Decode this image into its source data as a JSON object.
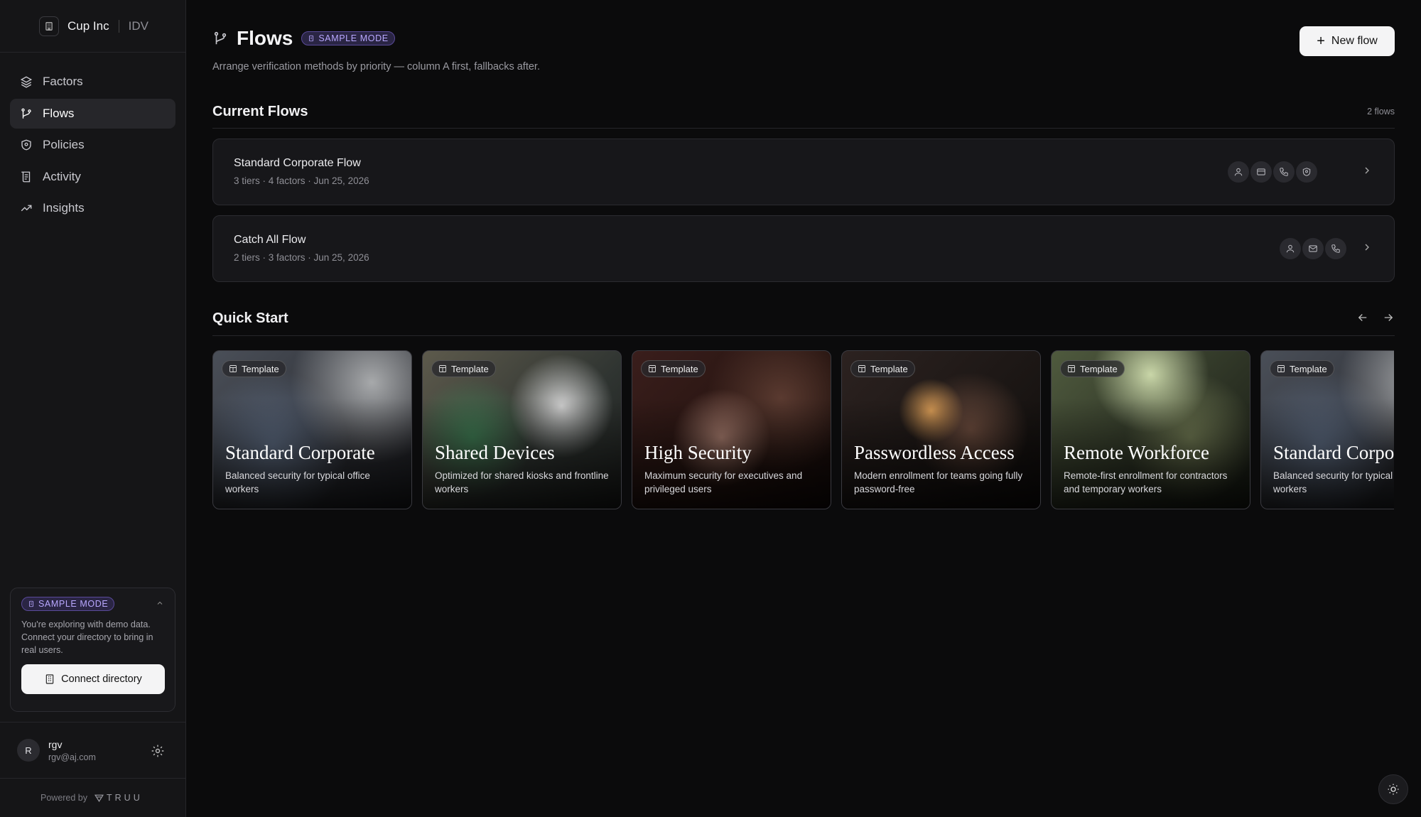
{
  "org": {
    "name": "Cup Inc",
    "product": "IDV"
  },
  "nav": [
    {
      "label": "Factors",
      "icon": "layers-icon"
    },
    {
      "label": "Flows",
      "icon": "flow-icon",
      "active": true
    },
    {
      "label": "Policies",
      "icon": "shield-icon"
    },
    {
      "label": "Activity",
      "icon": "activity-log-icon"
    },
    {
      "label": "Insights",
      "icon": "trend-icon"
    }
  ],
  "sample": {
    "badge": "SAMPLE MODE",
    "text": "You're exploring with demo data. Connect your directory to bring in real users.",
    "button": "Connect directory"
  },
  "user": {
    "initial": "R",
    "name": "rgv",
    "email": "rgv@aj.com"
  },
  "footer": {
    "powered": "Powered by",
    "brand": "TRUU"
  },
  "page": {
    "title": "Flows",
    "badge": "SAMPLE MODE",
    "description": "Arrange verification methods by priority — column A first, fallbacks after.",
    "new_button": "New flow"
  },
  "current_flows": {
    "title": "Current Flows",
    "count": "2 flows",
    "items": [
      {
        "name": "Standard Corporate Flow",
        "meta": "3 tiers · 4 factors · Jun 25, 2026",
        "factors": [
          "person-icon",
          "card-icon",
          "phone-icon",
          "shield-icon"
        ]
      },
      {
        "name": "Catch All Flow",
        "meta": "2 tiers · 3 factors · Jun 25, 2026",
        "factors": [
          "person-icon",
          "mail-icon",
          "phone-icon"
        ]
      }
    ]
  },
  "quick_start": {
    "title": "Quick Start",
    "templates": [
      {
        "badge": "Template",
        "title": "Standard Corporate",
        "desc": "Balanced security for typical office workers"
      },
      {
        "badge": "Template",
        "title": "Shared Devices",
        "desc": "Optimized for shared kiosks and frontline workers"
      },
      {
        "badge": "Template",
        "title": "High Security",
        "desc": "Maximum security for executives and privileged users"
      },
      {
        "badge": "Template",
        "title": "Passwordless Access",
        "desc": "Modern enrollment for teams going fully password-free"
      },
      {
        "badge": "Template",
        "title": "Remote Workforce",
        "desc": "Remote-first enrollment for contractors and temporary workers"
      },
      {
        "badge": "Template",
        "title": "Standard Corporate",
        "desc": "Balanced security for typical office workers"
      }
    ]
  }
}
